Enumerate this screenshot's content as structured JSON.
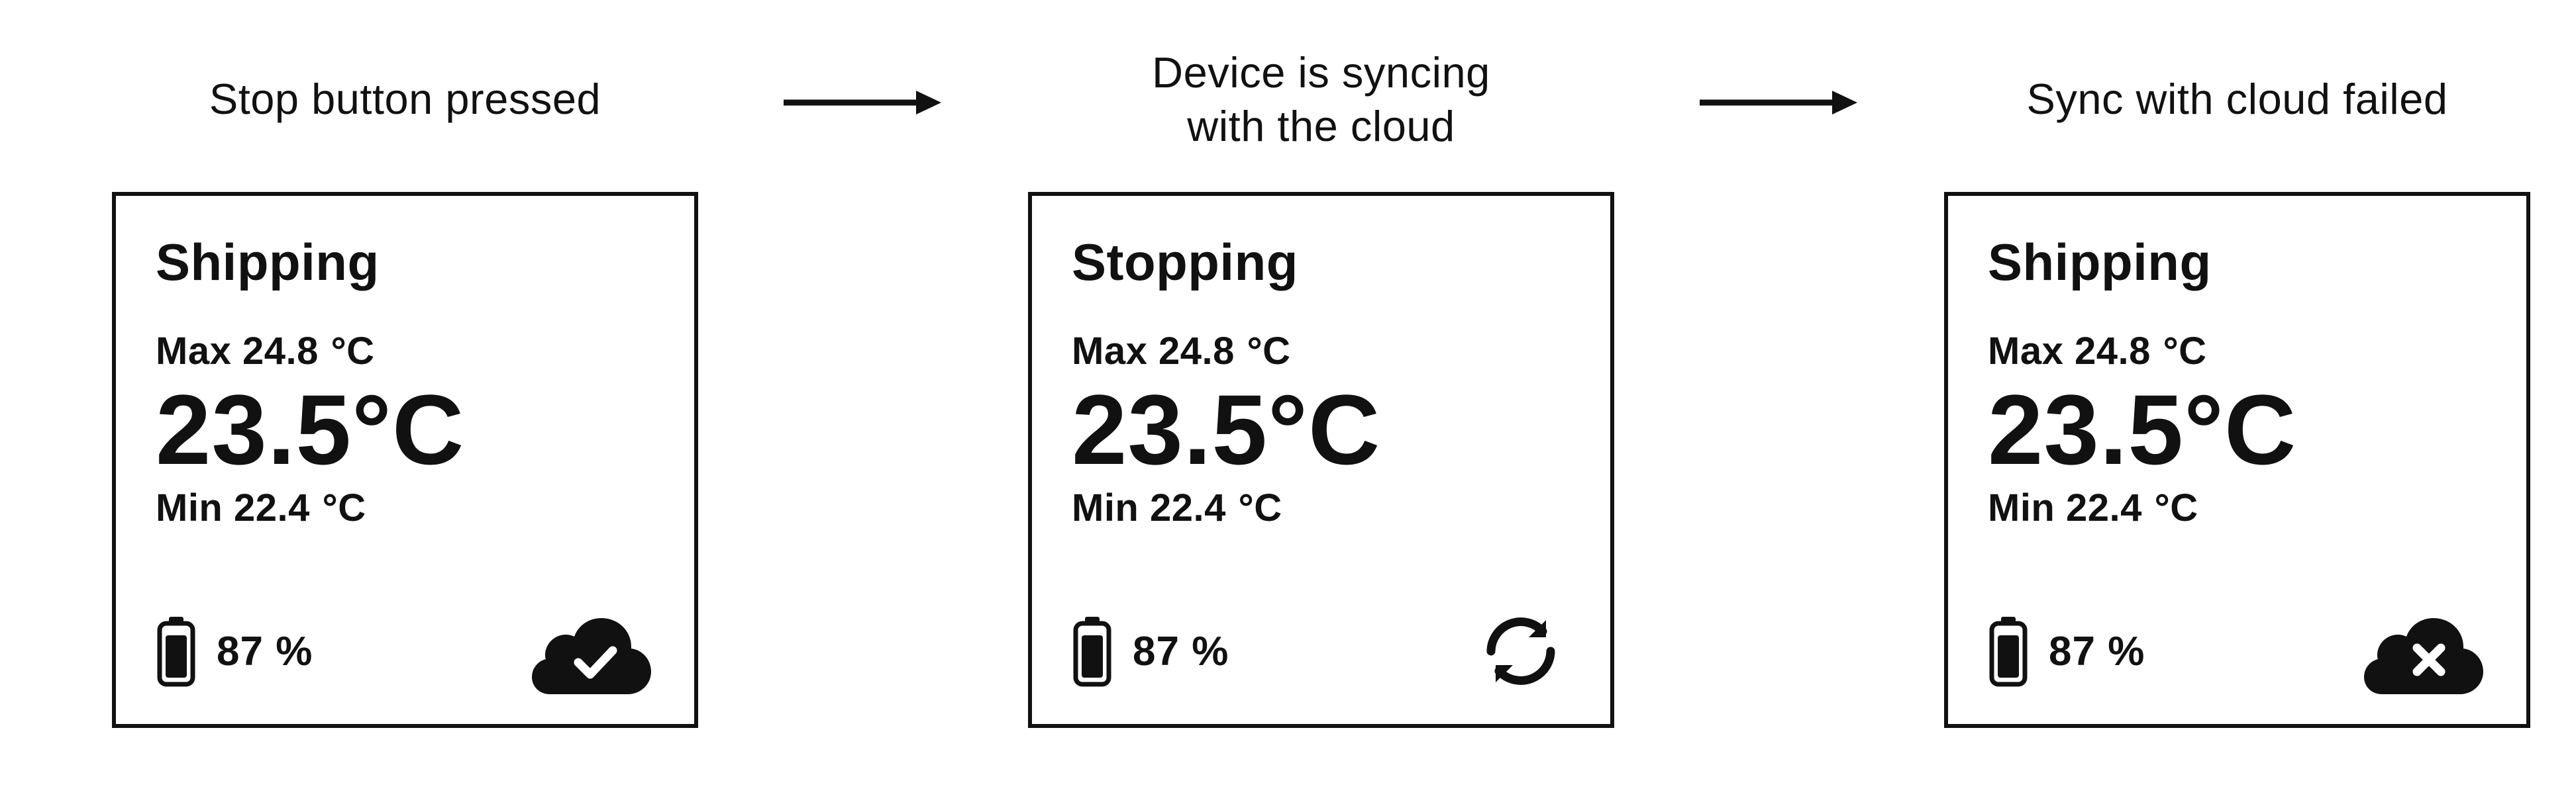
{
  "steps": [
    {
      "label": "Stop button pressed",
      "screen": {
        "status": "Shipping",
        "max_label": "Max",
        "max_value": "24.8",
        "main_temp": "23.5",
        "min_label": "Min",
        "min_value": "22.4",
        "unit": "°C",
        "battery_pct": "87 %",
        "cloud_state": "ok"
      }
    },
    {
      "label": "Device is syncing\nwith the cloud",
      "screen": {
        "status": "Stopping",
        "max_label": "Max",
        "max_value": "24.8",
        "main_temp": "23.5",
        "min_label": "Min",
        "min_value": "22.4",
        "unit": "°C",
        "battery_pct": "87 %",
        "cloud_state": "sync"
      }
    },
    {
      "label": "Sync with cloud failed",
      "screen": {
        "status": "Shipping",
        "max_label": "Max",
        "max_value": "24.8",
        "main_temp": "23.5",
        "min_label": "Min",
        "min_value": "22.4",
        "unit": "°C",
        "battery_pct": "87 %",
        "cloud_state": "fail"
      }
    }
  ]
}
